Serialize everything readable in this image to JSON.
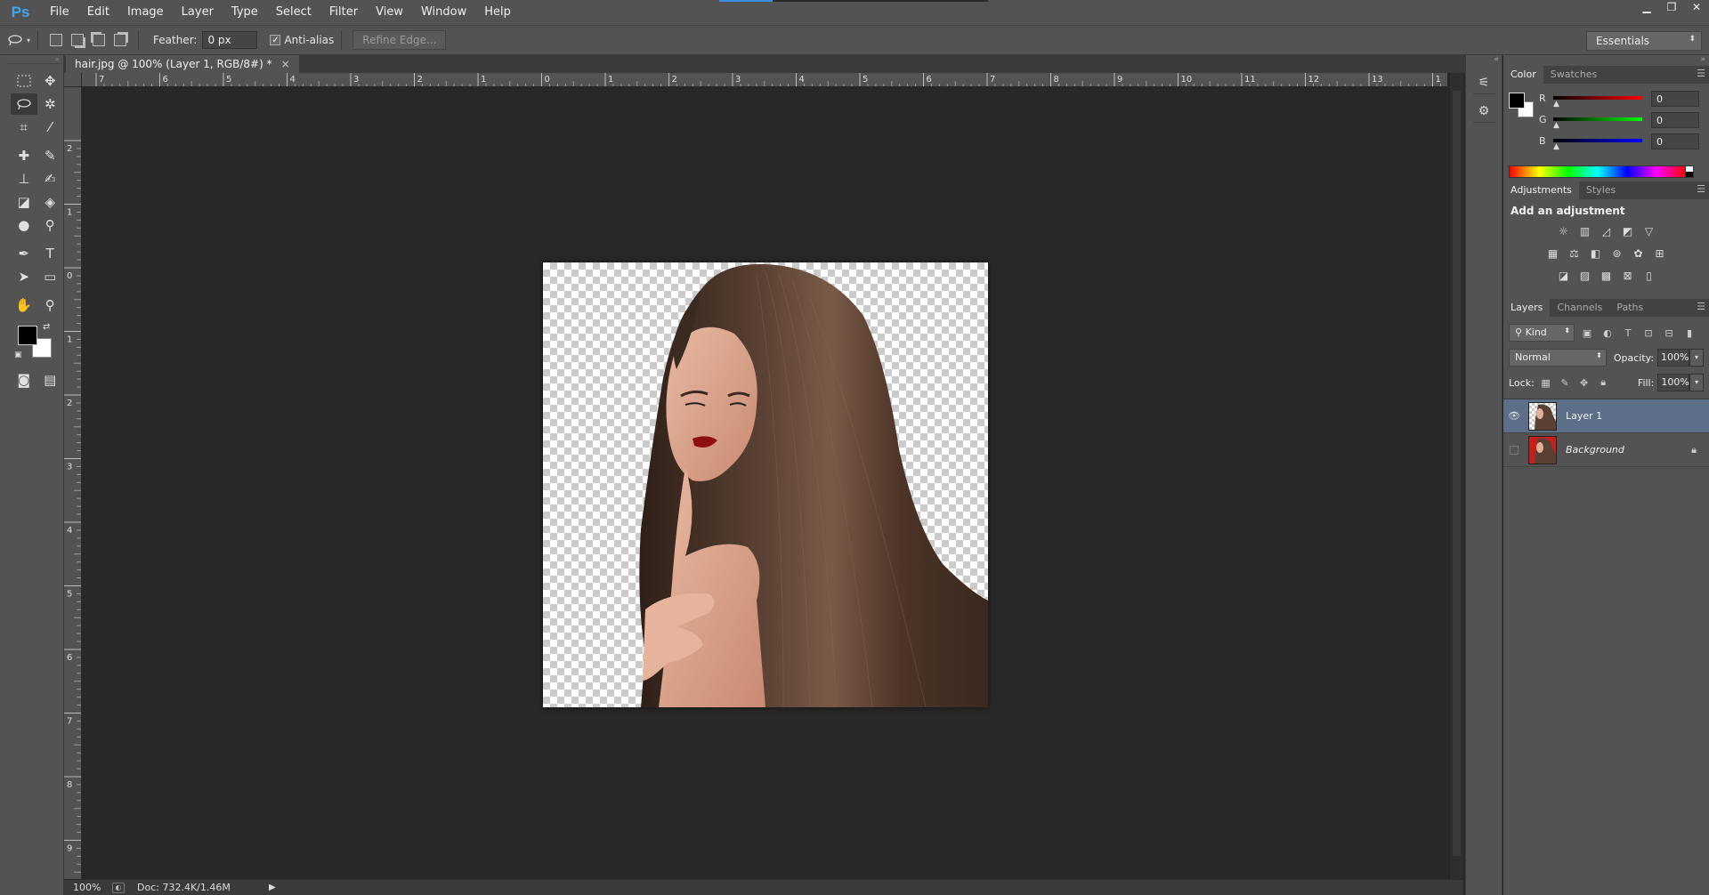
{
  "app": {
    "logo": "Ps"
  },
  "menu": [
    "File",
    "Edit",
    "Image",
    "Layer",
    "Type",
    "Select",
    "Filter",
    "View",
    "Window",
    "Help"
  ],
  "window_controls": {
    "minimize": "▁",
    "restore": "❐",
    "close": "✕"
  },
  "options": {
    "feather_label": "Feather:",
    "feather_value": "0 px",
    "antialias_label": "Anti-alias",
    "antialias_checked": true,
    "refine_edge_label": "Refine Edge...",
    "workspace": "Essentials"
  },
  "document": {
    "tab_title": "hair.jpg @ 100% (Layer 1, RGB/8#) *",
    "close": "×"
  },
  "rulers": {
    "top": [
      "7",
      "6",
      "5",
      "4",
      "3",
      "2",
      "1",
      "0",
      "1",
      "2",
      "3",
      "4",
      "5",
      "6",
      "7",
      "8",
      "9",
      "10",
      "11",
      "12",
      "13",
      "1"
    ],
    "left": [
      "2",
      "1",
      "0",
      "1",
      "2",
      "3",
      "4",
      "5",
      "6",
      "7",
      "8",
      "9"
    ]
  },
  "status": {
    "zoom": "100%",
    "doc_info": "Doc: 732.4K/1.46M"
  },
  "color_panel": {
    "tabs": [
      "Color",
      "Swatches"
    ],
    "channels": [
      {
        "label": "R",
        "value": "0",
        "color": "#e02020"
      },
      {
        "label": "G",
        "value": "0",
        "color": "#20c020"
      },
      {
        "label": "B",
        "value": "0",
        "color": "#2040e0"
      }
    ],
    "foreground": "#000000",
    "background": "#ffffff"
  },
  "adjustments_panel": {
    "tabs": [
      "Adjustments",
      "Styles"
    ],
    "title": "Add an adjustment"
  },
  "layers_panel": {
    "tabs": [
      "Layers",
      "Channels",
      "Paths"
    ],
    "kind_label": "Kind",
    "blend_mode": "Normal",
    "opacity_label": "Opacity:",
    "opacity_value": "100%",
    "lock_label": "Lock:",
    "fill_label": "Fill:",
    "fill_value": "100%",
    "layers": [
      {
        "name": "Layer 1",
        "visible": true,
        "selected": true
      },
      {
        "name": "Background",
        "visible": false,
        "selected": false,
        "locked": true
      }
    ]
  },
  "colors": {
    "accent": "#3a8ee6",
    "selection": "#5d6f88",
    "panel_bg": "#535353",
    "canvas_bg": "#282828"
  }
}
